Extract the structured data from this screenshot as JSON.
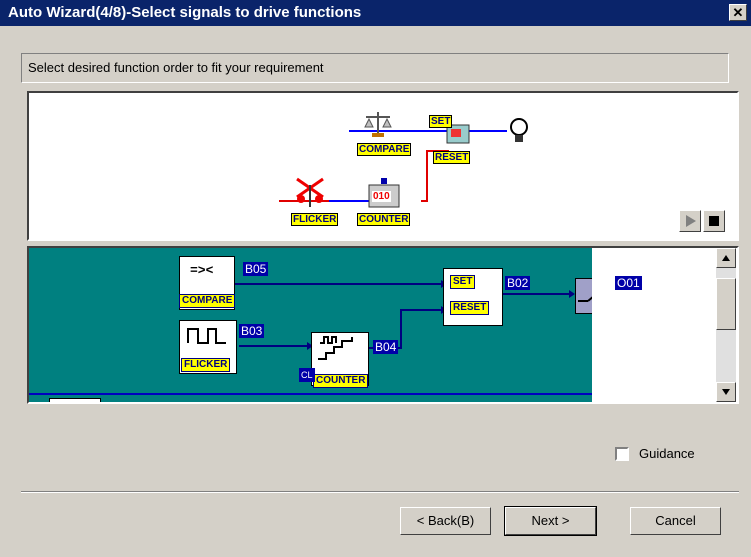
{
  "window": {
    "title": "Auto Wizard(4/8)-Select signals to drive functions",
    "close": "✕"
  },
  "instruction": "Select desired function order to fit your requirement",
  "animation": {
    "labels": {
      "compare": "COMPARE",
      "set": "SET",
      "reset": "RESET",
      "flicker": "FLICKER",
      "counter": "COUNTER",
      "counter_digits": "010"
    }
  },
  "ladder": {
    "blocks": {
      "compare_symbol": "=><",
      "compare": "COMPARE",
      "flicker": "FLICKER",
      "counter": "COUNTER",
      "set": "SET",
      "reset": "RESET",
      "counter_cl": "CL"
    },
    "tags": {
      "b05": "B05",
      "b03": "B03",
      "b04": "B04",
      "b02": "B02",
      "o01": "O01"
    }
  },
  "guidance_label": "Guidance",
  "buttons": {
    "back": "< Back(B)",
    "next": "Next >",
    "cancel": "Cancel"
  },
  "colors": {
    "titlebar": "#0a246a",
    "ladder_bg": "#008080",
    "wire_red": "#e00000",
    "wire_blue": "#0000ff",
    "tag_bg": "#0000a8"
  }
}
